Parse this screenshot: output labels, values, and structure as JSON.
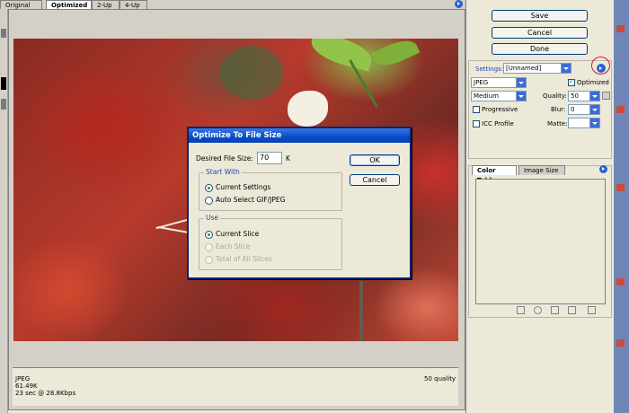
{
  "tabs": [
    {
      "label": "Original"
    },
    {
      "label": "Optimized"
    },
    {
      "label": "2-Up"
    },
    {
      "label": "4-Up"
    }
  ],
  "info": {
    "format": "JPEG",
    "size": "61.49K",
    "time": "23 sec @ 28.8Kbps",
    "quality": "50 quality"
  },
  "panel": {
    "save": "Save",
    "cancel": "Cancel",
    "done": "Done",
    "settings_label": "Settings:",
    "settings_value": "[Unnamed]",
    "format_value": "JPEG",
    "optimized_label": "Optimized",
    "quality_level": "Medium",
    "quality_label": "Quality:",
    "quality_value": "50",
    "progressive_label": "Progressive",
    "blur_label": "Blur:",
    "blur_value": "0",
    "icc_label": "ICC Profile",
    "matte_label": "Matte:",
    "tab_color_table": "Color Table",
    "tab_image_size": "Image Size"
  },
  "dialog": {
    "title": "Optimize To File Size",
    "desired_label": "Desired File Size:",
    "desired_value": "70",
    "unit": "K",
    "ok": "OK",
    "cancel": "Cancel",
    "start_with": "Start With",
    "current_settings": "Current Settings",
    "auto_select": "Auto Select GIF/JPEG",
    "use": "Use",
    "current_slice": "Current Slice",
    "each_slice": "Each Slice",
    "total_slices": "Total of All Slices"
  },
  "colors": {
    "accent": "#0a246a",
    "highlight_circle": "#e01010"
  }
}
